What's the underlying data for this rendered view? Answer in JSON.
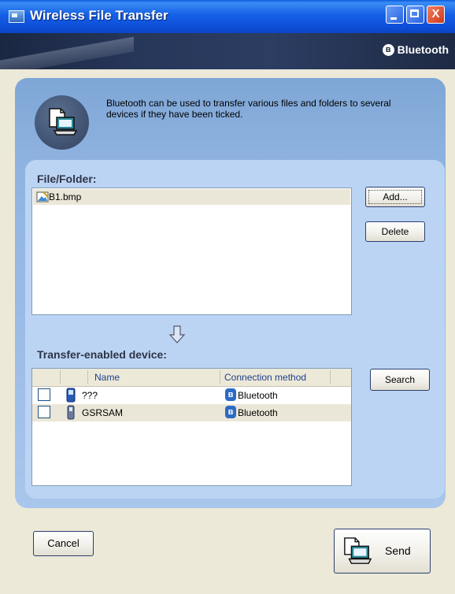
{
  "window": {
    "title": "Wireless File Transfer",
    "close_glyph": "X",
    "brand": "Bluetooth",
    "brand_glyph": "ʙ"
  },
  "info": {
    "text": "Bluetooth can be used to transfer various files and folders to several devices if they have been ticked."
  },
  "file_section": {
    "label": "File/Folder:",
    "files": [
      {
        "name": "B1.bmp",
        "icon": "bitmap-file-icon"
      }
    ],
    "add_label": "Add...",
    "delete_label": "Delete"
  },
  "device_section": {
    "label": "Transfer-enabled device:",
    "columns": [
      "Name",
      "Connection method"
    ],
    "devices": [
      {
        "name": "???",
        "connection": "Bluetooth",
        "checked": false,
        "icon": "phone-icon"
      },
      {
        "name": "GSRSAM",
        "connection": "Bluetooth",
        "checked": false,
        "icon": "phone-icon"
      }
    ],
    "search_label": "Search",
    "bt_glyph": "ʙ"
  },
  "footer": {
    "cancel_label": "Cancel",
    "send_label": "Send"
  },
  "colors": {
    "titlebar": "#0d4fd8",
    "panel": "#8fb3e0",
    "inner_panel": "#bcd4f4",
    "row_highlight": "#ebe7d8"
  }
}
